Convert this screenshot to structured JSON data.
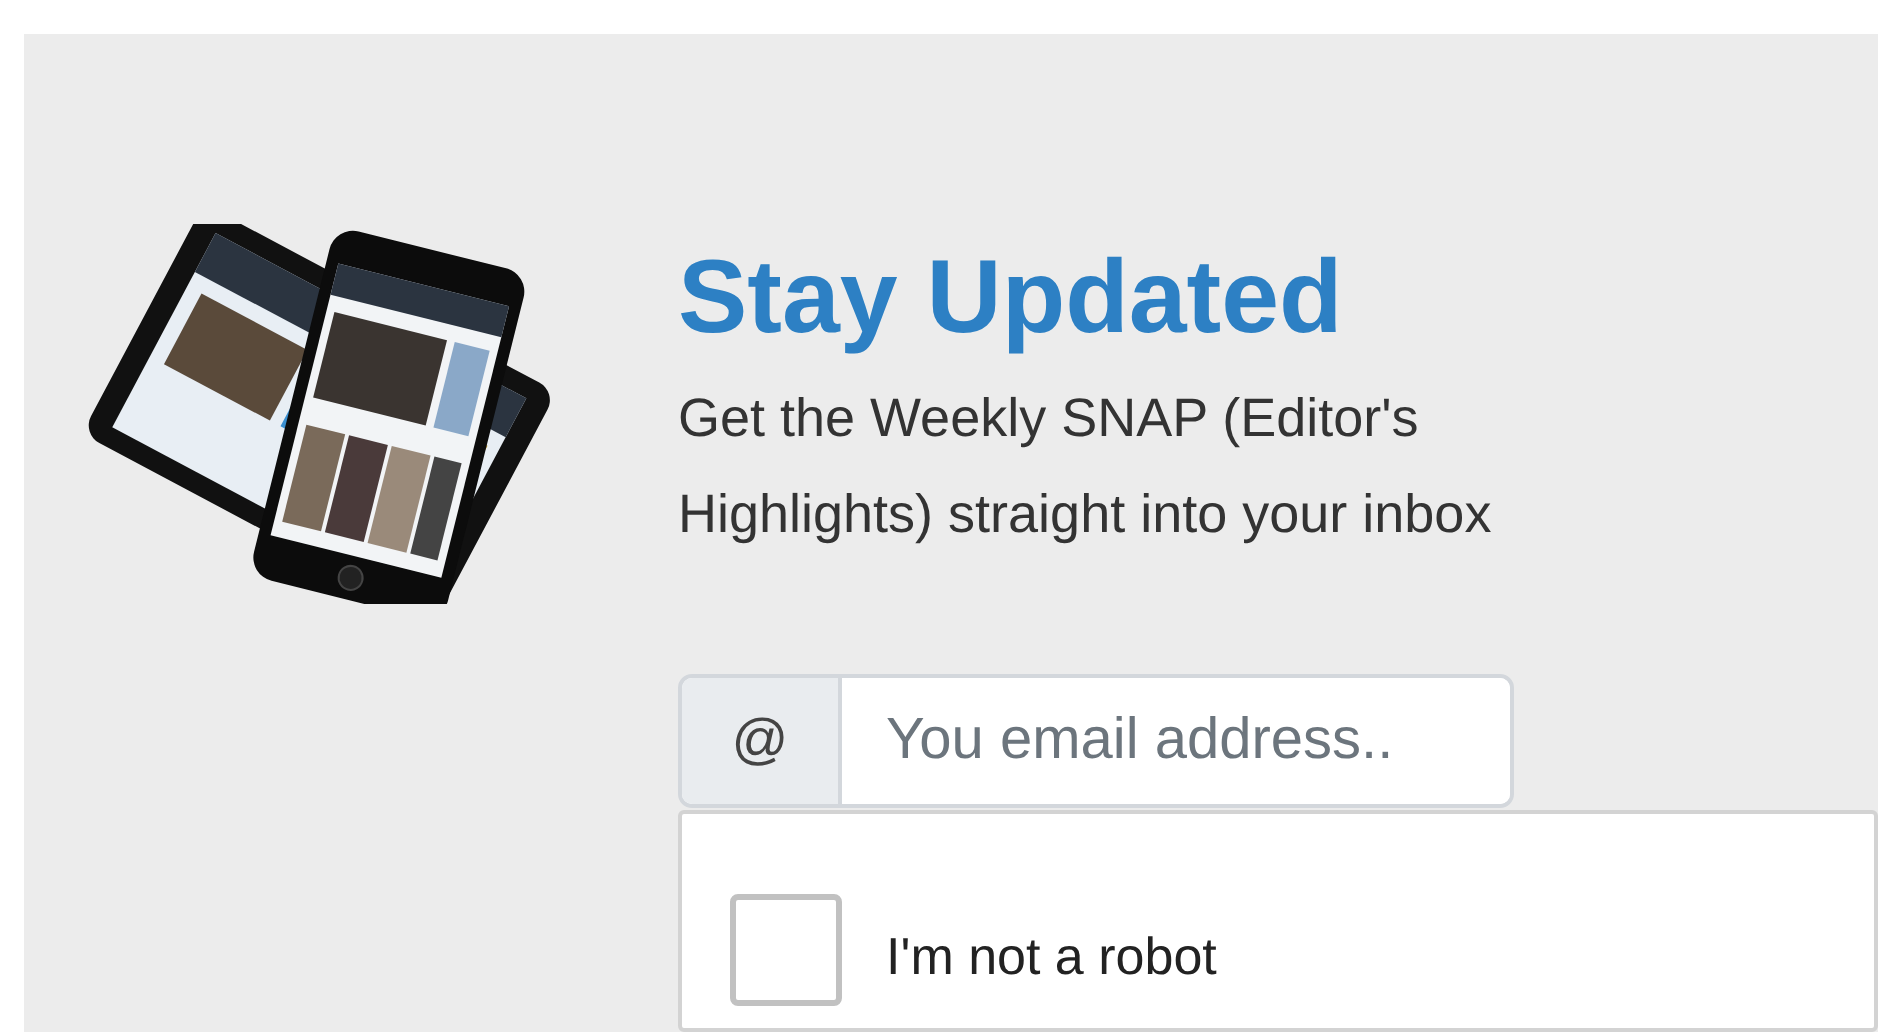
{
  "newsletter": {
    "title": "Stay Updated",
    "description": "Get the Weekly SNAP (Editor's Highlights) straight into your inbox"
  },
  "email_field": {
    "prefix": "@",
    "placeholder": "You email address.."
  },
  "captcha": {
    "label": "I'm not a robot",
    "checked": false
  }
}
